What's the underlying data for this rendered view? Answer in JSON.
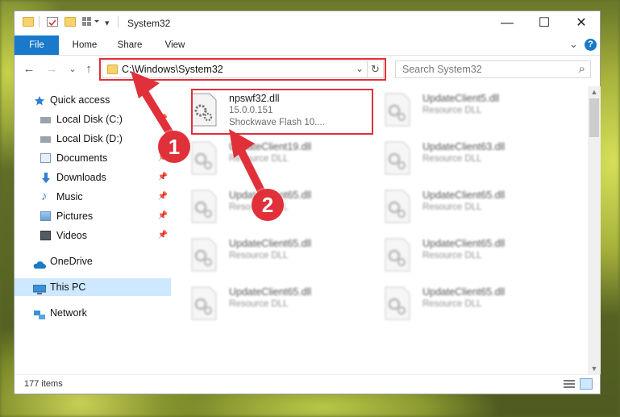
{
  "window": {
    "title": "System32",
    "minimize_glyph": "—",
    "maximize_glyph": "☐",
    "close_glyph": "✕",
    "help_glyph": "?",
    "ribbon_expand_glyph": "⌄"
  },
  "ribbon": {
    "tabs": [
      "File",
      "Home",
      "Share",
      "View"
    ]
  },
  "nav": {
    "back": "←",
    "forward": "→",
    "recent": "⌄",
    "up": "↑"
  },
  "address": {
    "path": "C:\\Windows\\System32",
    "dropdown_glyph": "⌄",
    "refresh_glyph": "↻"
  },
  "search": {
    "placeholder": "Search System32",
    "icon_glyph": "⌕"
  },
  "sidebar": {
    "items": [
      {
        "label": "Quick access",
        "icon": "star-icon"
      },
      {
        "label": "Local Disk (C:)",
        "icon": "drive-icon",
        "pinned": true
      },
      {
        "label": "Local Disk (D:)",
        "icon": "drive-icon"
      },
      {
        "label": "Documents",
        "icon": "documents-icon",
        "pinned": true
      },
      {
        "label": "Downloads",
        "icon": "download-icon",
        "pinned": true
      },
      {
        "label": "Music",
        "icon": "music-icon",
        "pinned": true
      },
      {
        "label": "Pictures",
        "icon": "pictures-icon",
        "pinned": true
      },
      {
        "label": "Videos",
        "icon": "videos-icon",
        "pinned": true
      },
      {
        "label": "OneDrive",
        "icon": "cloud-icon"
      },
      {
        "label": "This PC",
        "icon": "computer-icon",
        "selected": true
      },
      {
        "label": "Network",
        "icon": "network-icon"
      }
    ]
  },
  "files": [
    {
      "name": "npswf32.dll",
      "line2": "15.0.0.151",
      "line3": "Shockwave Flash 10....",
      "highlighted": true
    },
    {
      "name": "UpdateClient5.dll",
      "line2": "Resource DLL"
    },
    {
      "name": "UpdateClient19.dll",
      "line2": "Resource DLL"
    },
    {
      "name": "UpdateClient63.dll",
      "line2": "Resource DLL"
    },
    {
      "name": "UpdateClient65.dll",
      "line2": "Resource DLL"
    },
    {
      "name": "UpdateClient65.dll",
      "line2": "Resource DLL"
    },
    {
      "name": "UpdateClient65.dll",
      "line2": "Resource DLL"
    },
    {
      "name": "UpdateClient65.dll",
      "line2": "Resource DLL"
    },
    {
      "name": "UpdateClient65.dll",
      "line2": "Resource DLL"
    },
    {
      "name": "UpdateClient65.dll",
      "line2": "Resource DLL"
    }
  ],
  "status": {
    "item_count": "177 items"
  },
  "callouts": [
    {
      "label": "1"
    },
    {
      "label": "2"
    }
  ],
  "colors": {
    "accent": "#1979ca",
    "callout": "#e0303a",
    "selected": "#cde8ff"
  }
}
